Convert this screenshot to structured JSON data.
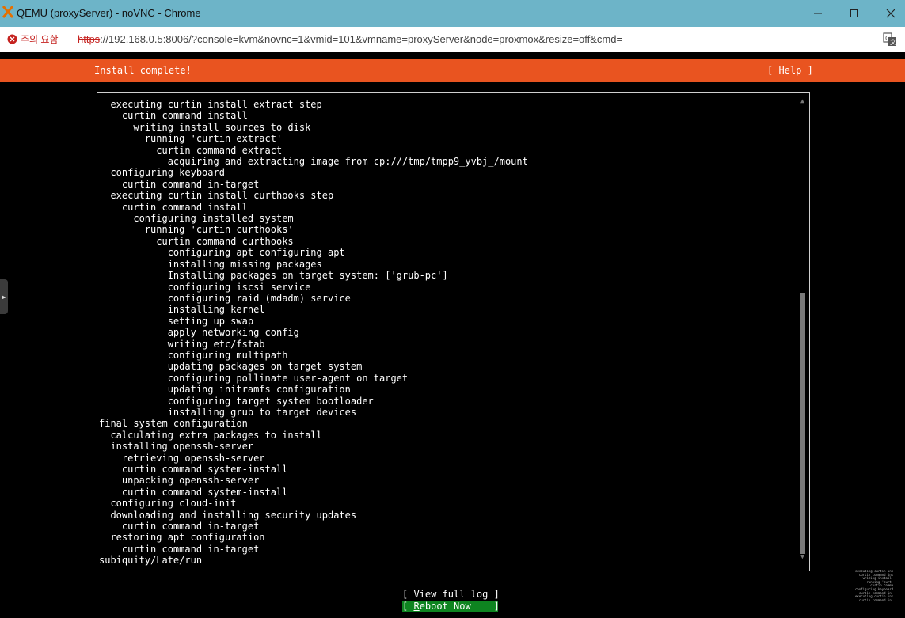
{
  "window": {
    "title": "QEMU (proxyServer) - noVNC - Chrome",
    "app_icon": "proxmox-x-icon",
    "controls": [
      "minimize-icon",
      "maximize-icon",
      "close-icon"
    ]
  },
  "address_bar": {
    "security_label": "주의 요함",
    "url_scheme": "https",
    "url_rest": "://192.168.0.5:8006/?console=kvm&novnc=1&vmid=101&vmname=proxyServer&node=proxmox&resize=off&cmd=",
    "translate_icon": "translate-icon"
  },
  "installer": {
    "header_title": "Install complete!",
    "help_label": "[ Help ]",
    "accent_color": "#e95420",
    "log_lines": [
      "  executing curtin install extract step",
      "    curtin command install",
      "      writing install sources to disk",
      "        running 'curtin extract'",
      "          curtin command extract",
      "            acquiring and extracting image from cp:///tmp/tmpp9_yvbj_/mount",
      "  configuring keyboard",
      "    curtin command in-target",
      "  executing curtin install curthooks step",
      "    curtin command install",
      "      configuring installed system",
      "        running 'curtin curthooks'",
      "          curtin command curthooks",
      "            configuring apt configuring apt",
      "            installing missing packages",
      "            Installing packages on target system: ['grub-pc']",
      "            configuring iscsi service",
      "            configuring raid (mdadm) service",
      "            installing kernel",
      "            setting up swap",
      "            apply networking config",
      "            writing etc/fstab",
      "            configuring multipath",
      "            updating packages on target system",
      "            configuring pollinate user-agent on target",
      "            updating initramfs configuration",
      "            configuring target system bootloader",
      "            installing grub to target devices",
      "final system configuration",
      "  calculating extra packages to install",
      "  installing openssh-server",
      "    retrieving openssh-server",
      "    curtin command system-install",
      "    unpacking openssh-server",
      "    curtin command system-install",
      "  configuring cloud-init",
      "  downloading and installing security updates",
      "    curtin command in-target",
      "  restoring apt configuration",
      "    curtin command in-target",
      "subiquity/Late/run"
    ],
    "view_log_label": "[ View full log ]",
    "reboot_label": "[ Reboot Now    ]",
    "reboot_color": "#0e8420"
  },
  "preview_lines": [
    "executing curtin ins",
    "  curtin command ins",
    "    writing install",
    "      running 'curt",
    "        curtin comma",
    "configuring keyboard",
    "  curtin command in",
    "executing curtin ins",
    "  curtin command in"
  ]
}
